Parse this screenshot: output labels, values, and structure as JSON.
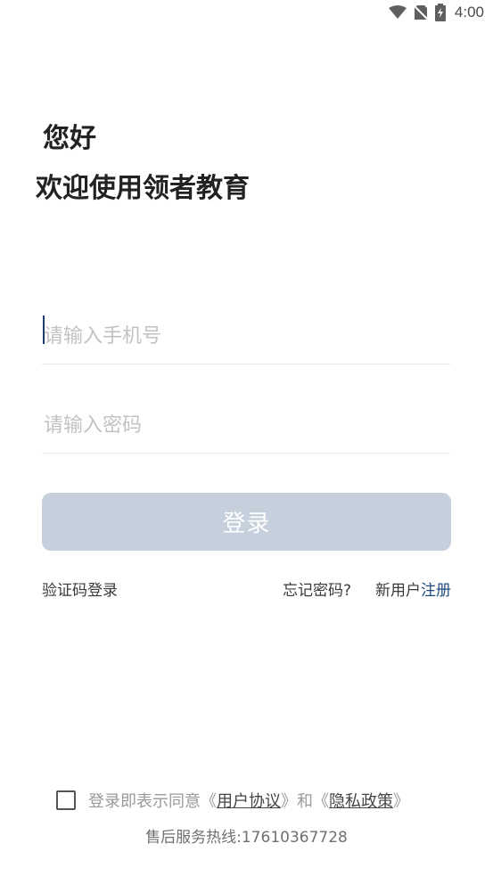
{
  "status_bar": {
    "time": "4:00",
    "icons": [
      "wifi-icon",
      "no-sim-icon",
      "battery-icon"
    ]
  },
  "header": {
    "greeting": "您好",
    "welcome": "欢迎使用领者教育"
  },
  "form": {
    "phone_placeholder": "请输入手机号",
    "phone_value": "",
    "password_placeholder": "请输入密码",
    "password_value": "",
    "login_label": "登录"
  },
  "links": {
    "sms_login": "验证码登录",
    "forgot_password": "忘记密码?",
    "new_user": "新用户",
    "register": "注册"
  },
  "agreement": {
    "checked": false,
    "prefix": "登录即表示同意《",
    "user_agreement": "用户协议",
    "middle": "》和《",
    "privacy_policy": "隐私政策",
    "suffix": "》"
  },
  "footer": {
    "hotline": "售后服务热线:17610367728"
  },
  "colors": {
    "button_disabled": "#c6d0dc",
    "link_accent": "#1e4b7c",
    "title_text": "#222222"
  }
}
